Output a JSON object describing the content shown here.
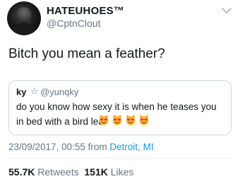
{
  "author": {
    "display_name": "HATEUHOES™",
    "handle": "@CptnClout"
  },
  "icons": {
    "menu": "chevron-down-icon",
    "star": "star-outline-icon",
    "emoji": "smiling-cat-heart-eyes-emoji"
  },
  "tweet": {
    "text": "Bitch you mean a feather?"
  },
  "quoted_tweet": {
    "name": "ky",
    "star": "☆",
    "handle": "@yunqky",
    "line1": "do you know how sexy it is when he teases you",
    "line2": "in bed with a bird leaf",
    "emoji_count": 4
  },
  "meta": {
    "timestamp": "23/09/2017, 00:55",
    "from_label": "from",
    "location": "Detroit, MI"
  },
  "stats": {
    "retweets_count": "55.7K",
    "retweets_label": "Retweets",
    "likes_count": "151K",
    "likes_label": "Likes"
  },
  "colors": {
    "link": "#1b95e0",
    "secondary_text": "#657786",
    "border": "#ccd6dd"
  }
}
